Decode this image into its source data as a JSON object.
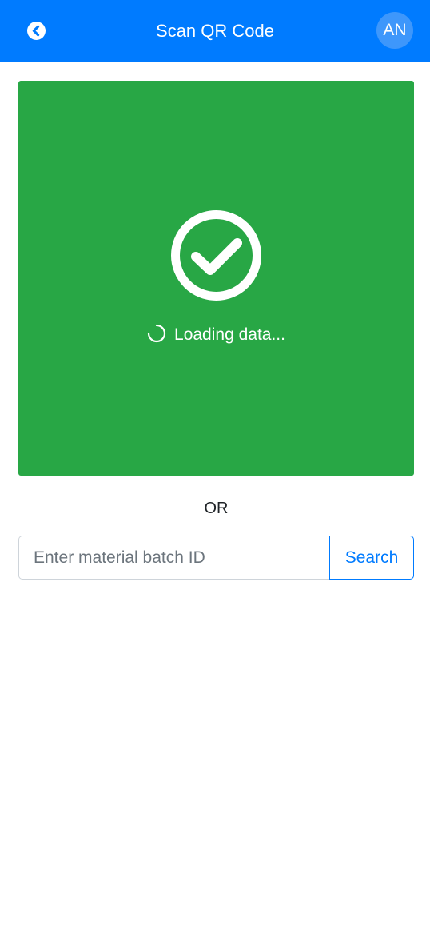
{
  "header": {
    "title": "Scan QR Code",
    "back_icon": "chevron-left-circle-icon",
    "avatar_initials": "AN",
    "background_color": "#007bff",
    "avatar_color": "#3e97fb"
  },
  "scanner": {
    "status_icon": "check-circle-icon",
    "loading_icon": "spinner-icon",
    "loading_text": "Loading data...",
    "background_color": "#28a745"
  },
  "divider": {
    "label": "OR"
  },
  "search": {
    "placeholder": "Enter material batch ID",
    "value": "",
    "button_label": "Search",
    "accent_color": "#007bff"
  }
}
